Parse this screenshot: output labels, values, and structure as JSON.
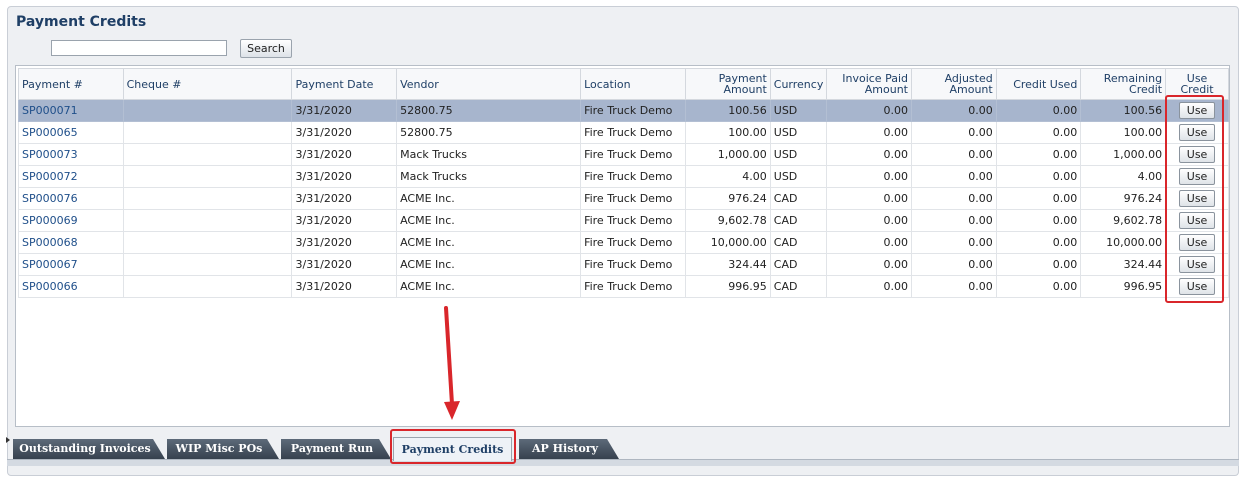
{
  "page": {
    "title": "Payment Credits"
  },
  "search": {
    "value": "",
    "button_label": "Search"
  },
  "table": {
    "columns": [
      "Payment #",
      "Cheque #",
      "Payment Date",
      "Vendor",
      "Location",
      "Payment Amount",
      "Currency",
      "Invoice Paid Amount",
      "Adjusted Amount",
      "Credit Used",
      "Remaining Credit",
      "Use Credit"
    ],
    "use_label": "Use",
    "rows": [
      {
        "payment": "SP000071",
        "cheque": "",
        "date": "3/31/2020",
        "vendor": "52800.75",
        "location": "Fire Truck Demo",
        "amount": "100.56",
        "currency": "USD",
        "invoice_paid": "0.00",
        "adjusted": "0.00",
        "credit_used": "0.00",
        "remaining": "100.56",
        "selected": true
      },
      {
        "payment": "SP000065",
        "cheque": "",
        "date": "3/31/2020",
        "vendor": "52800.75",
        "location": "Fire Truck Demo",
        "amount": "100.00",
        "currency": "USD",
        "invoice_paid": "0.00",
        "adjusted": "0.00",
        "credit_used": "0.00",
        "remaining": "100.00",
        "selected": false
      },
      {
        "payment": "SP000073",
        "cheque": "",
        "date": "3/31/2020",
        "vendor": "Mack Trucks",
        "location": "Fire Truck Demo",
        "amount": "1,000.00",
        "currency": "USD",
        "invoice_paid": "0.00",
        "adjusted": "0.00",
        "credit_used": "0.00",
        "remaining": "1,000.00",
        "selected": false
      },
      {
        "payment": "SP000072",
        "cheque": "",
        "date": "3/31/2020",
        "vendor": "Mack Trucks",
        "location": "Fire Truck Demo",
        "amount": "4.00",
        "currency": "USD",
        "invoice_paid": "0.00",
        "adjusted": "0.00",
        "credit_used": "0.00",
        "remaining": "4.00",
        "selected": false
      },
      {
        "payment": "SP000076",
        "cheque": "",
        "date": "3/31/2020",
        "vendor": "ACME Inc.",
        "location": "Fire Truck Demo",
        "amount": "976.24",
        "currency": "CAD",
        "invoice_paid": "0.00",
        "adjusted": "0.00",
        "credit_used": "0.00",
        "remaining": "976.24",
        "selected": false
      },
      {
        "payment": "SP000069",
        "cheque": "",
        "date": "3/31/2020",
        "vendor": "ACME Inc.",
        "location": "Fire Truck Demo",
        "amount": "9,602.78",
        "currency": "CAD",
        "invoice_paid": "0.00",
        "adjusted": "0.00",
        "credit_used": "0.00",
        "remaining": "9,602.78",
        "selected": false
      },
      {
        "payment": "SP000068",
        "cheque": "",
        "date": "3/31/2020",
        "vendor": "ACME Inc.",
        "location": "Fire Truck Demo",
        "amount": "10,000.00",
        "currency": "CAD",
        "invoice_paid": "0.00",
        "adjusted": "0.00",
        "credit_used": "0.00",
        "remaining": "10,000.00",
        "selected": false
      },
      {
        "payment": "SP000067",
        "cheque": "",
        "date": "3/31/2020",
        "vendor": "ACME Inc.",
        "location": "Fire Truck Demo",
        "amount": "324.44",
        "currency": "CAD",
        "invoice_paid": "0.00",
        "adjusted": "0.00",
        "credit_used": "0.00",
        "remaining": "324.44",
        "selected": false
      },
      {
        "payment": "SP000066",
        "cheque": "",
        "date": "3/31/2020",
        "vendor": "ACME Inc.",
        "location": "Fire Truck Demo",
        "amount": "996.95",
        "currency": "CAD",
        "invoice_paid": "0.00",
        "adjusted": "0.00",
        "credit_used": "0.00",
        "remaining": "996.95",
        "selected": false
      }
    ]
  },
  "tabs": [
    {
      "label": "Outstanding Invoices",
      "active": false
    },
    {
      "label": "WIP Misc POs",
      "active": false
    },
    {
      "label": "Payment Run",
      "active": false
    },
    {
      "label": "Payment Credits",
      "active": true
    },
    {
      "label": "AP History",
      "active": false
    }
  ],
  "colors": {
    "highlight": "#d9262b",
    "selected_row": "#a7b5cd",
    "link": "#1f4f8a"
  },
  "icons": {
    "annotation_arrow": "arrow-down-icon"
  }
}
